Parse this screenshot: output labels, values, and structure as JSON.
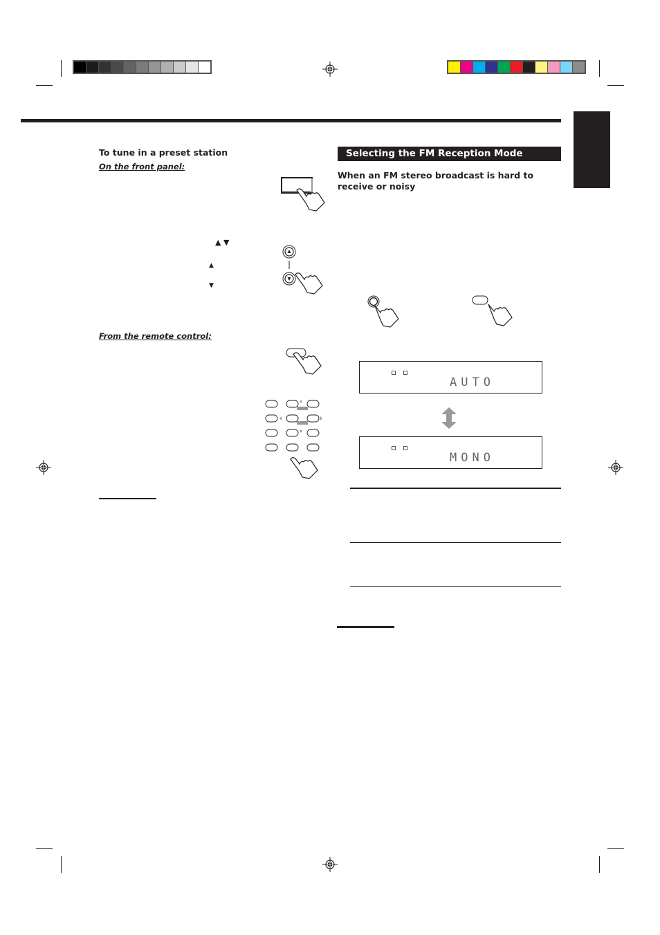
{
  "print_marks": {
    "gray_swatches": [
      "#000000",
      "#1b1b1b",
      "#333333",
      "#4a4a4a",
      "#636363",
      "#7b7b7b",
      "#959595",
      "#b0b0b0",
      "#cbcbcb",
      "#e5e5e5",
      "#ffffff"
    ],
    "color_swatches": [
      "#fff100",
      "#ec008c",
      "#00aeef",
      "#2e3192",
      "#00a651",
      "#ed1c24",
      "#231f20",
      "#fff57f",
      "#f49ac1",
      "#7dd4f8",
      "#8c8c8c"
    ]
  },
  "left_column": {
    "heading": "To tune in a preset station",
    "front_panel_label": "On the front panel:",
    "remote_label": "From the remote control:",
    "arrow_glyphs": {
      "up_down": "▲ ▼",
      "up": "▲",
      "down": "▼"
    }
  },
  "right_column": {
    "section_title": "Selecting the FM Reception Mode",
    "subheading": "When an FM stereo broadcast is hard to receive or noisy",
    "display_auto": "AUTO",
    "display_mono": "MONO"
  }
}
